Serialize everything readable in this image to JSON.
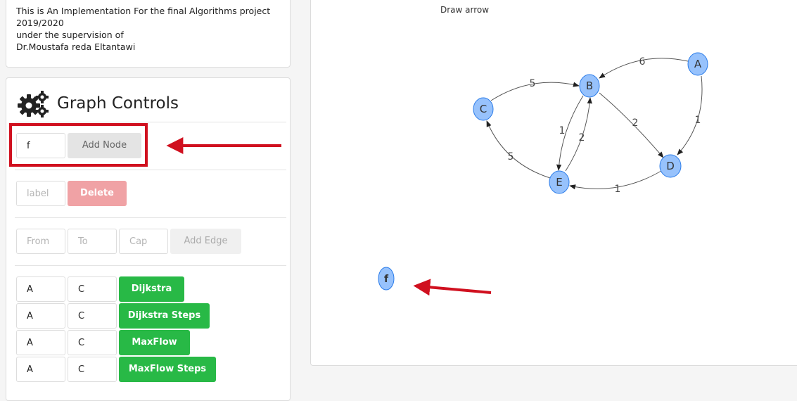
{
  "intro": {
    "line1": "This is An Implementation For the final Algorithms project",
    "line2": "2019/2020",
    "line3": "under the supervision of",
    "line4": "Dr.Moustafa reda Eltantawi"
  },
  "controls": {
    "icon": "gears-icon",
    "title": "Graph Controls",
    "add_node": {
      "value": "f",
      "button": "Add Node"
    },
    "delete": {
      "placeholder": "label",
      "button": "Delete"
    },
    "add_edge": {
      "from_placeholder": "From",
      "to_placeholder": "To",
      "cap_placeholder": "Cap",
      "button": "Add Edge"
    },
    "algorithms": [
      {
        "from": "A",
        "to": "C",
        "button": "Dijkstra"
      },
      {
        "from": "A",
        "to": "C",
        "button": "Dijkstra Steps"
      },
      {
        "from": "A",
        "to": "C",
        "button": "MaxFlow"
      },
      {
        "from": "A",
        "to": "C",
        "button": "MaxFlow Steps"
      }
    ]
  },
  "canvas": {
    "draw_arrow_label": "Draw arrow",
    "node_color": "#97c2fc",
    "node_border": "#2b7ce9",
    "annotation_color": "#d0101f",
    "nodes": [
      "A",
      "B",
      "C",
      "D",
      "E",
      "f"
    ],
    "edges": [
      {
        "from": "A",
        "to": "B",
        "weight": "6"
      },
      {
        "from": "C",
        "to": "B",
        "weight": "5"
      },
      {
        "from": "B",
        "to": "D",
        "weight": "2"
      },
      {
        "from": "A",
        "to": "D",
        "weight": "1"
      },
      {
        "from": "B",
        "to": "E",
        "weight": "1"
      },
      {
        "from": "E",
        "to": "B",
        "weight": "2"
      },
      {
        "from": "E",
        "to": "C",
        "weight": "5"
      },
      {
        "from": "D",
        "to": "E",
        "weight": "1"
      }
    ]
  }
}
